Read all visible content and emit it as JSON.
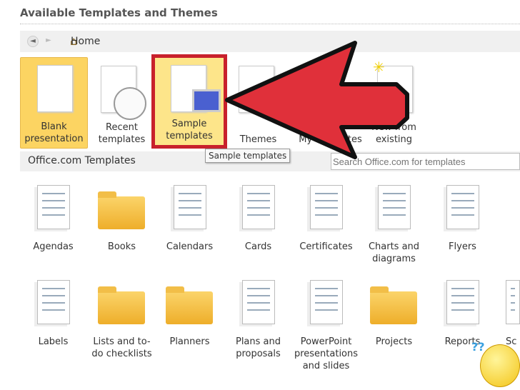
{
  "header": {
    "title": "Available Templates and Themes"
  },
  "nav": {
    "back": "◄",
    "forward": "►",
    "home": "Home"
  },
  "top_tiles": [
    {
      "label": "Blank presentation",
      "icon": "blank-doc-icon"
    },
    {
      "label": "Recent templates",
      "icon": "clock-icon"
    },
    {
      "label": "Sample templates",
      "icon": "computer-icon"
    },
    {
      "label": "Themes",
      "icon": "themes-icon"
    },
    {
      "label": "My templates",
      "icon": "doc-icon"
    },
    {
      "label": "New from existing",
      "icon": "new-doc-icon"
    }
  ],
  "tooltip": "Sample templates",
  "office": {
    "title": "Office.com Templates",
    "search_placeholder": "Search Office.com for templates"
  },
  "row1": [
    {
      "label": "Agendas",
      "type": "doc"
    },
    {
      "label": "Books",
      "type": "folder"
    },
    {
      "label": "Calendars",
      "type": "doc"
    },
    {
      "label": "Cards",
      "type": "doc"
    },
    {
      "label": "Certificates",
      "type": "doc"
    },
    {
      "label": "Charts and diagrams",
      "type": "doc"
    },
    {
      "label": "Flyers",
      "type": "doc"
    }
  ],
  "row2": [
    {
      "label": "Labels",
      "type": "doc"
    },
    {
      "label": "Lists and to-do checklists",
      "type": "folder"
    },
    {
      "label": "Planners",
      "type": "folder"
    },
    {
      "label": "Plans and proposals",
      "type": "doc"
    },
    {
      "label": "PowerPoint presentations and slides",
      "type": "doc"
    },
    {
      "label": "Projects",
      "type": "folder"
    },
    {
      "label": "Reports",
      "type": "doc"
    },
    {
      "label": "Sc",
      "type": "doc"
    }
  ],
  "colors": {
    "selected": "#fcd462",
    "arrow": "#e0303a",
    "highlight_box": "#c8202c"
  }
}
